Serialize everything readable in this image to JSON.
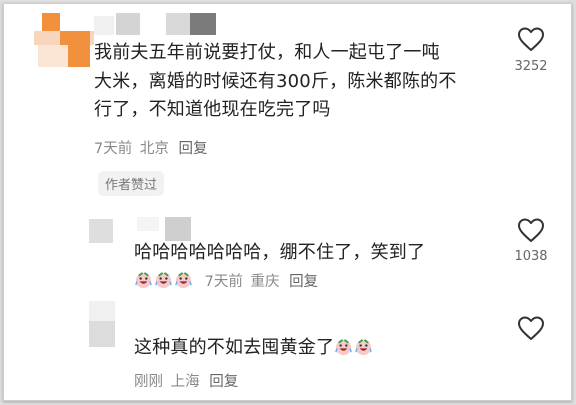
{
  "comments": [
    {
      "text_lines": [
        "我前夫五年前说要打仗，和人一起屯了一吨",
        "大米，离婚的时候还有300斤，陈米都陈的不",
        "行了，不知道他现在吃完了吗"
      ],
      "time": "7天前",
      "location": "北京",
      "reply": "回复",
      "likes": "3252",
      "badge": "作者赞过"
    },
    {
      "text": "哈哈哈哈哈哈哈，绷不住了，笑到了",
      "emoji": [
        "laughing-crying-emoji",
        "laughing-crying-emoji",
        "laughing-crying-emoji"
      ],
      "time": "7天前",
      "location": "重庆",
      "reply": "回复",
      "likes": "1038"
    },
    {
      "text": "这种真的不如去囤黄金了",
      "emoji": [
        "laughing-crying-emoji",
        "laughing-crying-emoji"
      ],
      "time": "刚刚",
      "location": "上海",
      "reply": "回复",
      "likes": ""
    }
  ],
  "icons": {
    "like": "heart-outline-icon",
    "avatar": "pixelated-avatar"
  },
  "colors": {
    "text": "#222222",
    "meta": "#8a8a8a",
    "avatar_orange": "#f2913d",
    "badge_bg": "#f2f2f2"
  }
}
